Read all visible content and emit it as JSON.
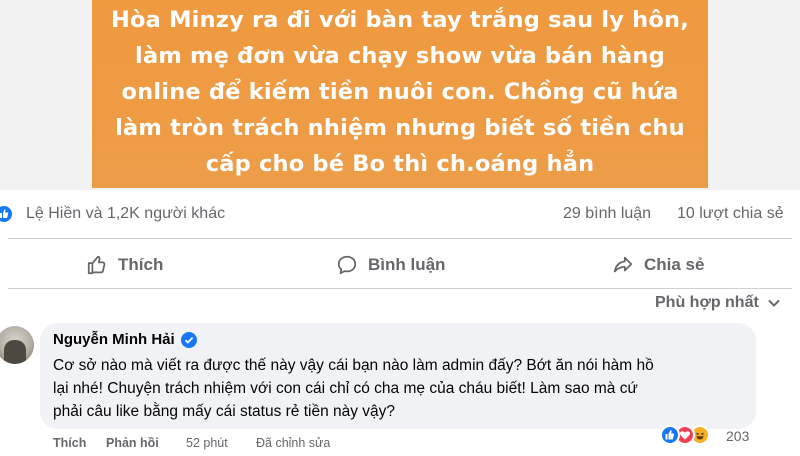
{
  "banner": {
    "lines": [
      "Hòa Minzy ra đi với bàn tay trắng sau ly hôn,",
      "làm mẹ đơn vừa chạy show vừa bán hàng",
      "online để kiếm tiền nuôi con. Chồng cũ hứa",
      "làm tròn trách nhiệm nhưng biết số tiền chu",
      "cấp cho bé Bo thì ch.oáng hẳn"
    ],
    "background_color": "#ee9b44"
  },
  "stats": {
    "reactors": "Lệ Hiền và 1,2K người khác",
    "comments": "29 bình luận",
    "shares": "10 lượt chia sẻ"
  },
  "actions": {
    "like": "Thích",
    "comment": "Bình luận",
    "share": "Chia sẻ"
  },
  "sort": {
    "label": "Phù hợp nhất"
  },
  "comment": {
    "author": "Nguyễn Minh Hải",
    "verified": true,
    "lines": [
      "Cơ sở nào mà viết ra được thế này vậy cái bạn nào làm admin đấy? Bớt ăn nói hàm hồ",
      "lại nhé! Chuyện trách nhiệm với con cái chỉ có cha mẹ của cháu biết! Làm sao mà cứ",
      "phải câu like bằng mấy cái status rẻ tiền này vậy?"
    ],
    "like": "Thích",
    "reply": "Phản hồi",
    "time": "52 phút",
    "edited": "Đã chỉnh sửa",
    "reaction_count": "203",
    "reaction_icons": [
      "like-icon",
      "heart-icon",
      "haha-icon"
    ]
  },
  "colors": {
    "accent": "#1877f2",
    "secondary_text": "#65676b",
    "bubble": "#f0f2f5"
  }
}
